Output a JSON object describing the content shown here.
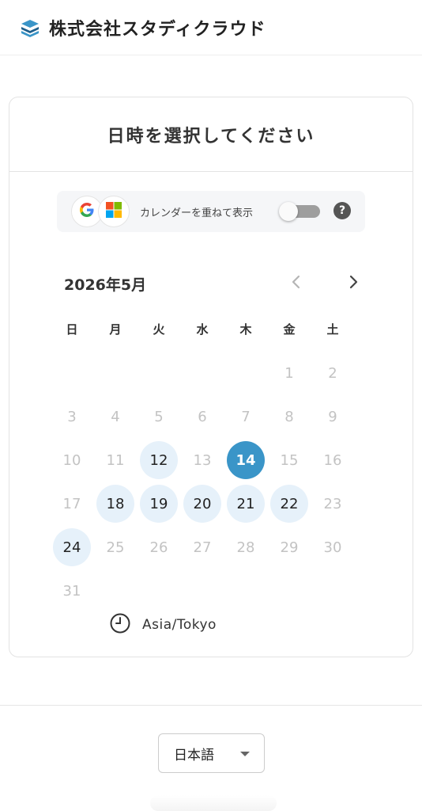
{
  "header": {
    "company_name": "株式会社スタディクラウド",
    "logo_icon": "stacked-books-icon"
  },
  "card": {
    "title": "日時を選択してください",
    "calendar_overlay": {
      "label": "カレンダーを重ねて表示",
      "providers": [
        "google-icon",
        "microsoft-icon"
      ],
      "enabled": false,
      "help_symbol": "?"
    },
    "calendar": {
      "month_label": "2026年5月",
      "weekdays": [
        "日",
        "月",
        "火",
        "水",
        "木",
        "金",
        "土"
      ],
      "first_weekday_index": 5,
      "days_in_month": 31,
      "available_days": [
        12,
        18,
        19,
        20,
        21,
        22,
        24
      ],
      "selected_day": 14
    },
    "timezone": "Asia/Tokyo"
  },
  "footer": {
    "language": "日本語"
  },
  "colors": {
    "selected": "#3a95c8",
    "available_bg": "#e6f1fa",
    "disabled_text": "#c3c3c3"
  }
}
